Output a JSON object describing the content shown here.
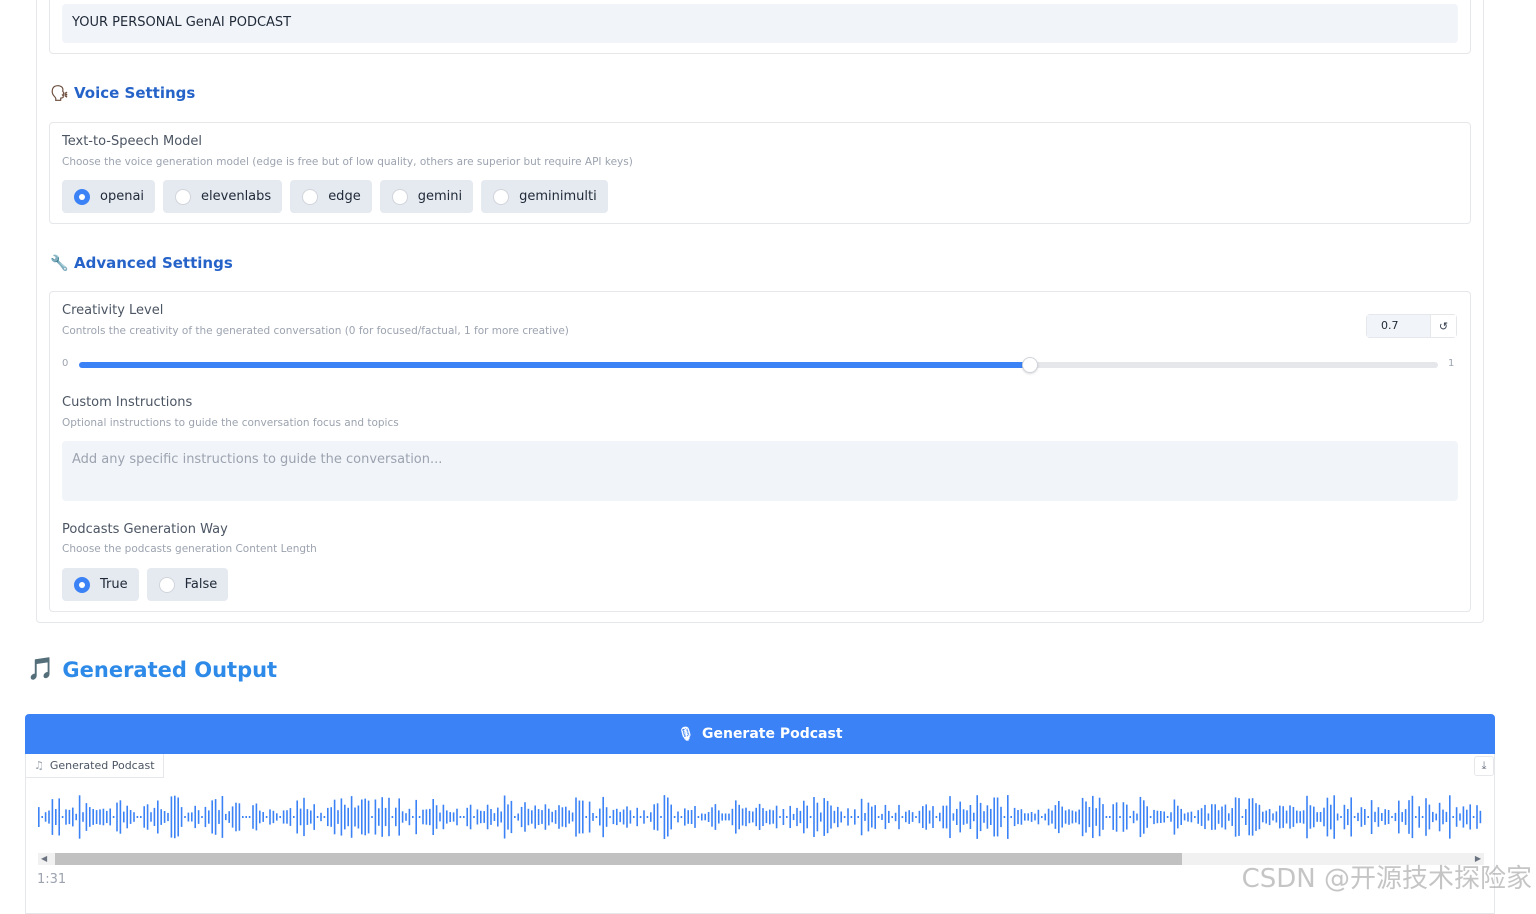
{
  "podcast_name": {
    "value": "YOUR PERSONAL GenAI PODCAST"
  },
  "voice_settings": {
    "icon": "speaking-head-emoji",
    "heading": "Voice Settings",
    "tts_model": {
      "label": "Text-to-Speech Model",
      "hint": "Choose the voice generation model (edge is free but of low quality, others are superior but require API keys)",
      "options": [
        "openai",
        "elevenlabs",
        "edge",
        "gemini",
        "geminimulti"
      ],
      "selected": "openai"
    }
  },
  "advanced_settings": {
    "icon": "wrench-emoji",
    "heading": "Advanced Settings",
    "creativity": {
      "label": "Creativity Level",
      "hint": "Controls the creativity of the generated conversation (0 for focused/factual, 1 for more creative)",
      "value": "0.7",
      "min": "0",
      "max": "1",
      "fraction": 0.7
    },
    "custom_instructions": {
      "label": "Custom Instructions",
      "hint": "Optional instructions to guide the conversation focus and topics",
      "placeholder": "Add any specific instructions to guide the conversation..."
    },
    "generation_way": {
      "label": "Podcasts Generation Way",
      "hint": "Choose the podcasts generation Content Length",
      "options": [
        "True",
        "False"
      ],
      "selected": "True"
    }
  },
  "output": {
    "icon": "musical-notes-emoji",
    "heading": "Generated Output",
    "generate_button": "Generate Podcast",
    "audio_label": "Generated Podcast",
    "time": "1:31"
  },
  "watermark": "CSDN @开源技术探险家",
  "colors": {
    "accent": "#3b82f6",
    "heading": "#2563c9",
    "output_heading": "#2d8ae8"
  }
}
